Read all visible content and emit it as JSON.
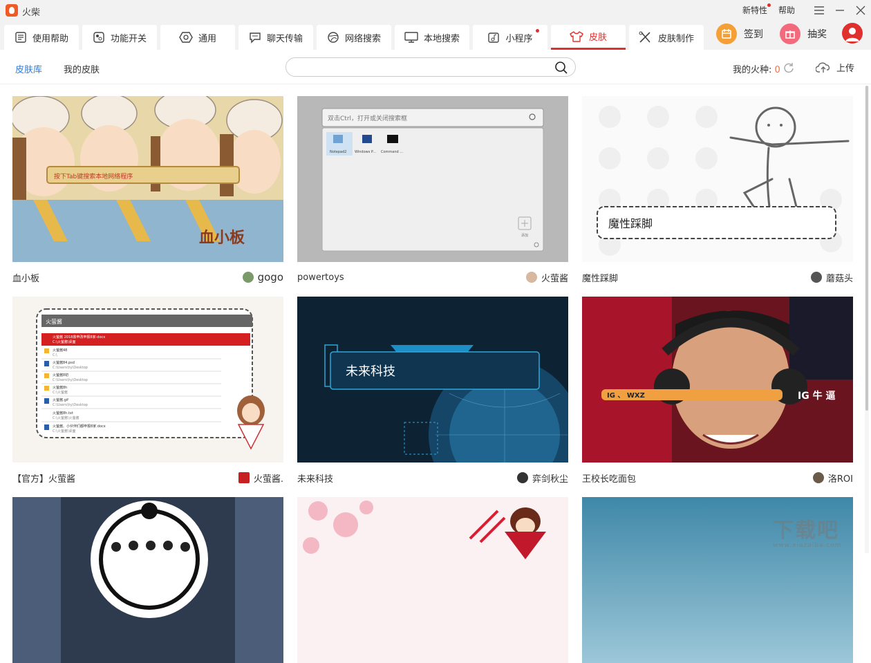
{
  "app": {
    "title": "火柴"
  },
  "top_links": {
    "whats_new": "新特性",
    "help": "帮助"
  },
  "tabs": [
    {
      "label": "使用帮助",
      "icon": "book-icon"
    },
    {
      "label": "功能开关",
      "icon": "toggle-icon"
    },
    {
      "label": "通用",
      "icon": "hexagon-icon"
    },
    {
      "label": "聊天传输",
      "icon": "chat-icon"
    },
    {
      "label": "网络搜索",
      "icon": "globe-icon"
    },
    {
      "label": "本地搜索",
      "icon": "monitor-icon"
    },
    {
      "label": "小程序",
      "icon": "music-icon"
    },
    {
      "label": "皮肤",
      "icon": "shirt-icon",
      "active": true
    },
    {
      "label": "皮肤制作",
      "icon": "tools-icon"
    }
  ],
  "actions": {
    "checkin": "签到",
    "lottery": "抽奖"
  },
  "subnav": {
    "library": "皮肤库",
    "mine": "我的皮肤"
  },
  "search": {
    "placeholder": "",
    "value": ""
  },
  "seeds": {
    "label": "我的火种:",
    "count": "0"
  },
  "upload": {
    "label": "上传"
  },
  "colors": {
    "accent": "#e0302e",
    "link_blue": "#2a7ee0"
  },
  "skins": [
    {
      "title": "血小板",
      "author": "gogo",
      "image_text": "血小板",
      "banner_text": "按下Tab键搜索本地网络程序"
    },
    {
      "title": "powertoys",
      "author": "火萤酱",
      "image_text": "双击Ctrl，打开或关闭搜索框",
      "apps": [
        "Notepad2",
        "Windows P...",
        "Command ..."
      ],
      "add_label": "添加"
    },
    {
      "title": "魔性踩脚",
      "author": "蘑菇头",
      "image_text": "魔性踩脚"
    },
    {
      "title": "【官方】火萤酱",
      "author": "火萤酱.",
      "image_text": "火萤酱",
      "file_rows": [
        {
          "name": "火萤酱 2018鼎申改申报8家-docx",
          "path": "C:\\火萤酱\\桌面"
        },
        {
          "name": "火萤酱48",
          "path": "C:\\"
        },
        {
          "name": "火萤酱84.psd",
          "path": "C:\\Users\\hy\\Desktop"
        },
        {
          "name": "火萤酱8初",
          "path": "C:\\Users\\hy\\Desktop"
        },
        {
          "name": "火萤酱8h",
          "path": "C:\\火萤酱"
        },
        {
          "name": "火萤酱.gif",
          "path": "C:\\Users\\hy\\Desktop"
        },
        {
          "name": "火萤酱8h.txt",
          "path": "C:\\火萤酱\\火萤酱"
        },
        {
          "name": "火萤酱、小伙伴们都申报8家.docx",
          "path": "C:\\火萤酱\\桌面"
        }
      ]
    },
    {
      "title": "未来科技",
      "author": "弈剑秋尘",
      "image_text": "未来科技"
    },
    {
      "title": "王校长吃面包",
      "author": "洛ROI",
      "image_text": "IG 、 WXZ",
      "tag": "IG 牛 逼"
    },
    {
      "title": "",
      "author": ""
    },
    {
      "title": "",
      "author": ""
    },
    {
      "title": "",
      "author": ""
    }
  ],
  "watermark": {
    "main": "下载吧",
    "sub": "www.xiazaiba.com"
  }
}
